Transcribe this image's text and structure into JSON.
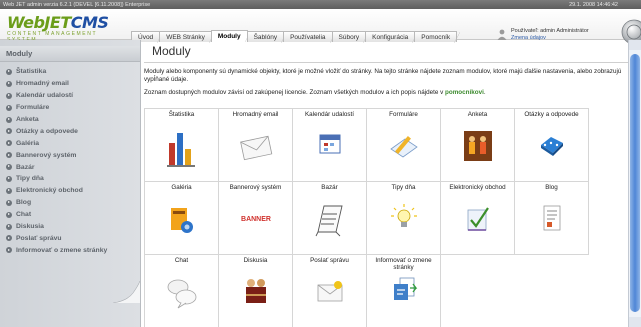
{
  "window": {
    "title": "Web JET admin verzia 6.2.1 (DEVEL [6.11.2008]) Enterprise",
    "datetime": "29.1. 2008 14:46:42"
  },
  "logo": {
    "main_a": "WebJET",
    "main_b": "CMS",
    "sub": "CONTENT MANAGEMENT SYSTEM"
  },
  "tabs": [
    {
      "label": "Úvod"
    },
    {
      "label": "WEB Stránky"
    },
    {
      "label": "Moduly",
      "active": true
    },
    {
      "label": "Šablóny"
    },
    {
      "label": "Používatelia"
    },
    {
      "label": "Súbory"
    },
    {
      "label": "Konfigurácia"
    },
    {
      "label": "Pomocník"
    }
  ],
  "user": {
    "line1": "Používateľ: admin Administrátor",
    "change": "Zmena údajov"
  },
  "sidebar": {
    "title": "Moduly",
    "items": [
      "Štatistika",
      "Hromadný email",
      "Kalendár udalostí",
      "Formuláre",
      "Anketa",
      "Otázky a odpovede",
      "Galéria",
      "Bannerový systém",
      "Bazár",
      "Tipy dňa",
      "Elektronický obchod",
      "Blog",
      "Chat",
      "Diskusia",
      "Poslať správu",
      "Informovať o zmene stránky"
    ]
  },
  "main": {
    "title": "Moduly",
    "intro": "Moduly alebo komponenty sú dynamické objekty, ktoré je možné vložiť do stránky. Na tejto stránke nájdete zoznam modulov, ktoré majú ďalšie nastavenia, alebo zobrazujú vypĺňané údaje.",
    "note_before": "Zoznam dostupných modulov závisí od zakúpenej licencie. Zoznam všetkých modulov a ich popis nájdete v ",
    "note_link": "pomocníkovi",
    "note_after": ".",
    "modules": [
      {
        "label": "Štatistika",
        "icon": "statistics-chart-icon"
      },
      {
        "label": "Hromadný email",
        "icon": "envelope-icon"
      },
      {
        "label": "Kalendár udalostí",
        "icon": "calendar-icon"
      },
      {
        "label": "Formuláre",
        "icon": "form-pencil-icon"
      },
      {
        "label": "Anketa",
        "icon": "poll-people-icon"
      },
      {
        "label": "Otázky a odpovede",
        "icon": "qa-network-icon"
      },
      {
        "label": "Galéria",
        "icon": "gallery-icon"
      },
      {
        "label": "Bannerový systém",
        "icon": "banner-icon",
        "text": "BANNER"
      },
      {
        "label": "Bazár",
        "icon": "bazaar-sign-icon"
      },
      {
        "label": "Tipy dňa",
        "icon": "lightbulb-icon"
      },
      {
        "label": "Elektronický obchod",
        "icon": "eshop-check-icon"
      },
      {
        "label": "Blog",
        "icon": "blog-document-icon"
      },
      {
        "label": "Chat",
        "icon": "chat-bubbles-icon"
      },
      {
        "label": "Diskusia",
        "icon": "discussion-icon"
      },
      {
        "label": "Poslať správu",
        "icon": "send-message-icon"
      },
      {
        "label": "Informovať o zmene stránky",
        "icon": "notify-change-icon"
      }
    ]
  },
  "colors": {
    "brand_green": "#6b9d1a",
    "brand_blue": "#1f4fa3",
    "help_link": "#3b8a2d"
  }
}
